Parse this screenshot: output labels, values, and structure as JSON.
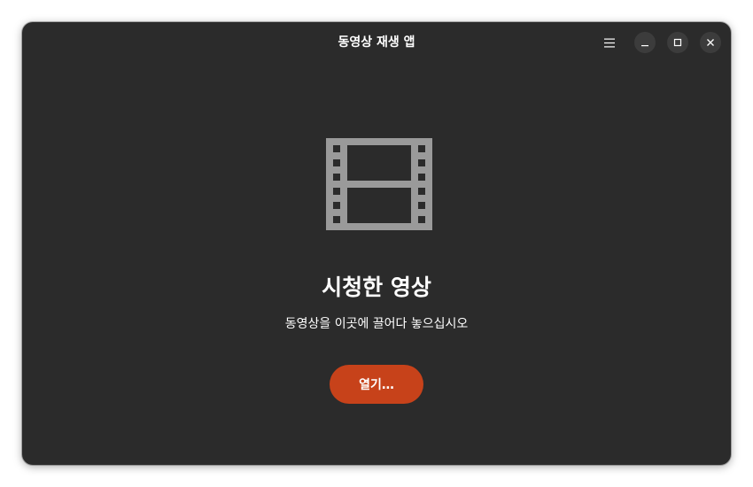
{
  "window": {
    "title": "동영상 재생 앱"
  },
  "titlebar": {
    "menu_icon": "hamburger-menu-icon",
    "minimize_icon": "minimize-icon",
    "maximize_icon": "maximize-icon",
    "close_icon": "close-icon"
  },
  "empty_state": {
    "icon": "film-icon",
    "heading": "시청한 영상",
    "description": "동영상을 이곳에 끌어다 놓으십시오",
    "open_button_label": "열기…"
  },
  "colors": {
    "window_bg": "#2b2b2b",
    "accent": "#c7421a",
    "icon_gray": "#9a9a9a",
    "control_bg": "#3c3c3c"
  }
}
